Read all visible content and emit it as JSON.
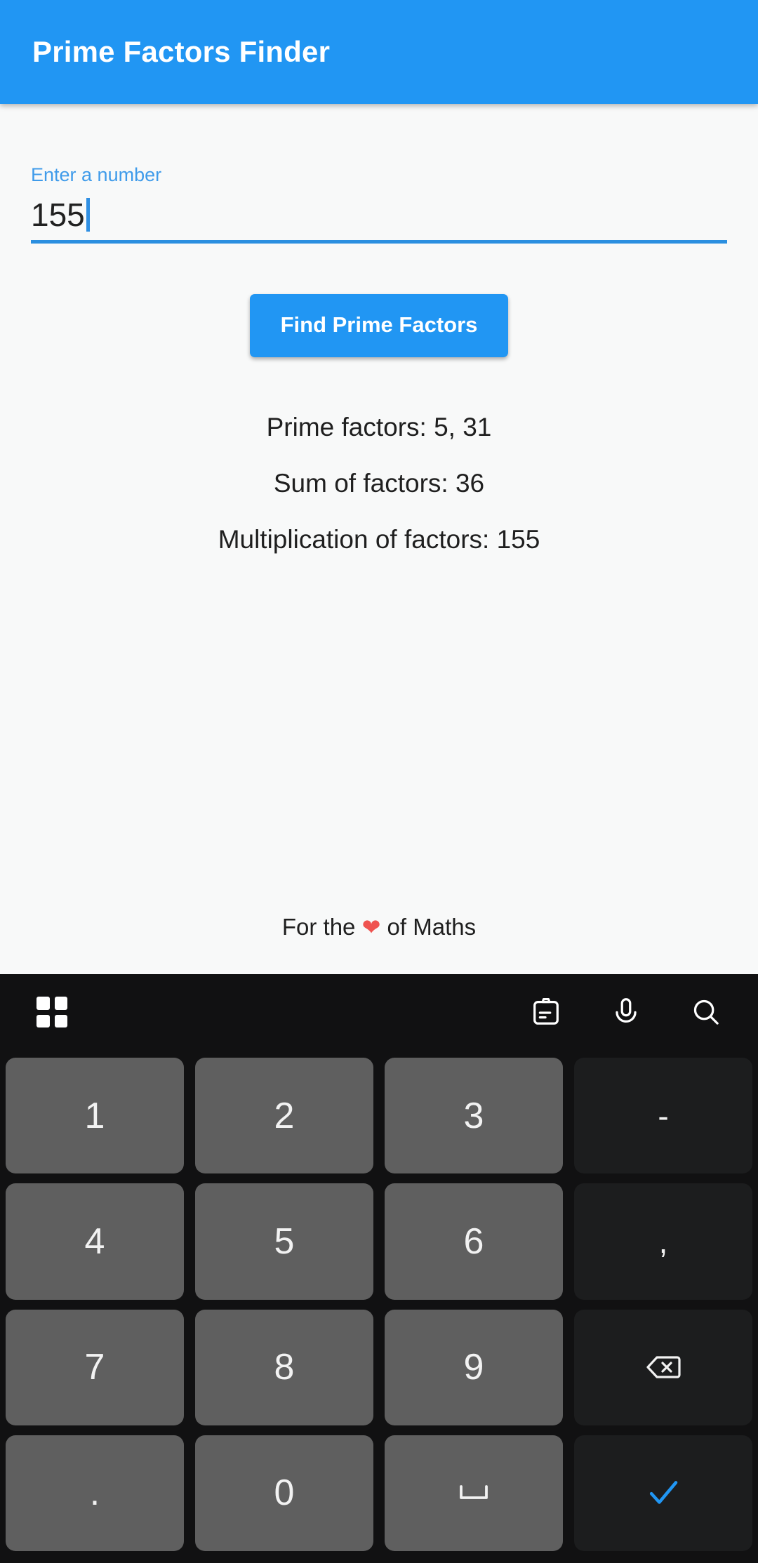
{
  "appbar": {
    "title": "Prime Factors Finder",
    "bg": "#2196f3",
    "text_color": "#ffffff"
  },
  "form": {
    "label": "Enter a number",
    "value": "155",
    "placeholder": "Enter a number",
    "accent": "#2196f3"
  },
  "action": {
    "find_label": "Find Prime Factors"
  },
  "results": [
    "Prime factors: 5, 31",
    "Sum of factors: 36",
    "Multiplication of factors: 155"
  ],
  "result_values": {
    "prime_factors": "5, 31",
    "sum_of_factors": "36",
    "multiplication_of_factors": "155"
  },
  "footer": {
    "prefix": "For the ",
    "heart": "❤",
    "suffix": " of Maths",
    "heart_color": "#ef5350"
  },
  "keyboard": {
    "toolbar": {
      "left_icon": "grid-icon",
      "right_icons": [
        "clipboard-icon",
        "microphone-icon",
        "search-icon"
      ]
    },
    "rows": [
      [
        {
          "label": "1",
          "name": "key-1",
          "type": "num"
        },
        {
          "label": "2",
          "name": "key-2",
          "type": "num"
        },
        {
          "label": "3",
          "name": "key-3",
          "type": "num"
        },
        {
          "label": "-",
          "name": "key-minus",
          "type": "fn"
        }
      ],
      [
        {
          "label": "4",
          "name": "key-4",
          "type": "num"
        },
        {
          "label": "5",
          "name": "key-5",
          "type": "num"
        },
        {
          "label": "6",
          "name": "key-6",
          "type": "num"
        },
        {
          "label": ",",
          "name": "key-comma",
          "type": "fn"
        }
      ],
      [
        {
          "label": "7",
          "name": "key-7",
          "type": "num"
        },
        {
          "label": "8",
          "name": "key-8",
          "type": "num"
        },
        {
          "label": "9",
          "name": "key-9",
          "type": "num"
        },
        {
          "label": "",
          "name": "key-backspace",
          "type": "fn",
          "icon": "backspace-icon"
        }
      ],
      [
        {
          "label": ".",
          "name": "key-period",
          "type": "num"
        },
        {
          "label": "0",
          "name": "key-0",
          "type": "num"
        },
        {
          "label": "",
          "name": "key-space",
          "type": "num",
          "icon": "space-icon"
        },
        {
          "label": "",
          "name": "key-enter",
          "type": "fn",
          "icon": "check-icon"
        }
      ]
    ],
    "key_bg": "#5f5f5f",
    "fn_key_bg": "#1c1d1e",
    "bg": "#111112",
    "enter_color": "#2196f3"
  }
}
